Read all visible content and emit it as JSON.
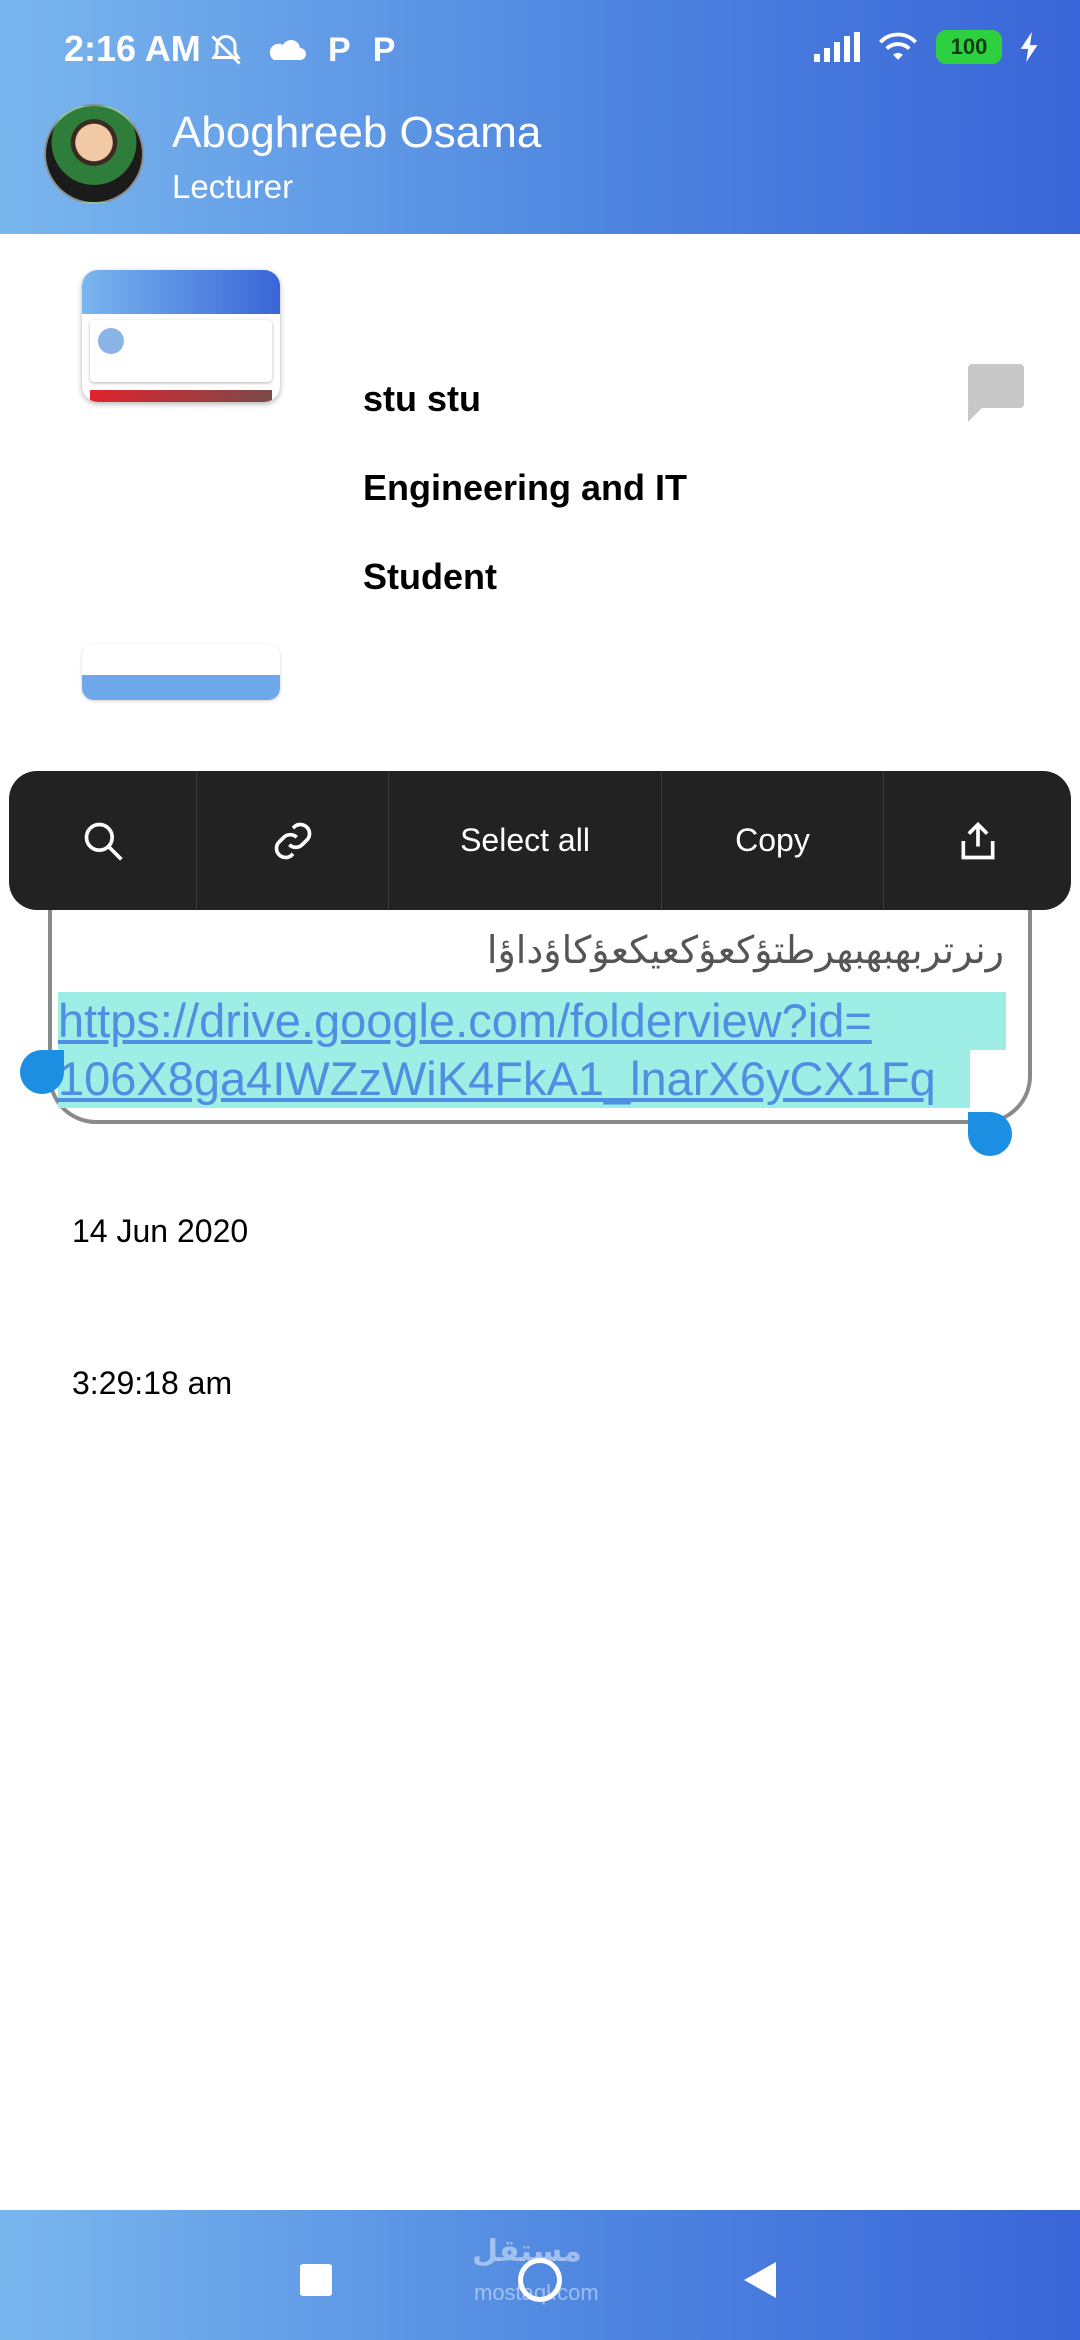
{
  "status_bar": {
    "time": "2:16 AM",
    "notification_icons": [
      "bell-off-icon",
      "cloud-icon",
      "p-app-icon",
      "p-app-icon"
    ],
    "p_label": "P",
    "battery": "100"
  },
  "header": {
    "name": "Aboghreeb Osama",
    "role": "Lecturer"
  },
  "post": {
    "name": "stu stu",
    "department": "Engineering and IT",
    "role": "Student"
  },
  "selection_toolbar": {
    "select_all": "Select all",
    "copy": "Copy"
  },
  "message": {
    "arabic_text": "رنرتربهبهبهرطتؤكعؤكعيكعؤكاؤداؤا",
    "link_line1": "https://drive.google.com/folderview?id=",
    "link_line2": "106X8ga4IWZzWiK4FkA1_lnarX6yCX1Fq",
    "date": "14 Jun 2020",
    "time": "3:29:18 am"
  },
  "watermark": {
    "arabic": "مستقل",
    "latin": "mostaql.com"
  },
  "colors": {
    "header_gradient_start": "#7ab6ee",
    "header_gradient_end": "#3a65d8",
    "selection_highlight": "#9eeee6",
    "selection_handle": "#1d8fe2",
    "toolbar_bg": "#222222"
  }
}
